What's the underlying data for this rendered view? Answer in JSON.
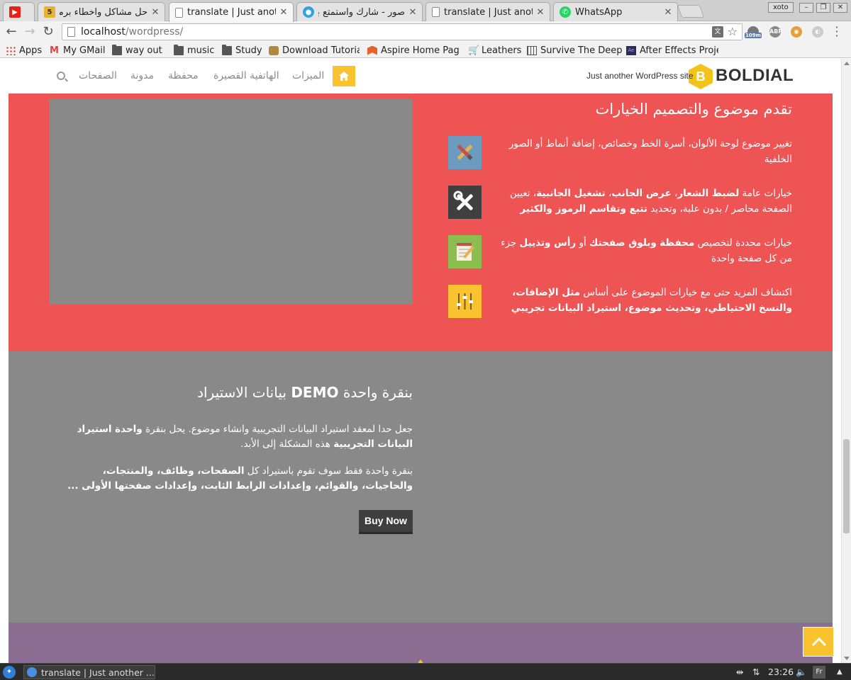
{
  "browser": {
    "tabs": [
      {
        "title": "",
        "favicon": "youtube-icon",
        "color": "#e62117"
      },
      {
        "title": "حل مشاكل واخطاء برمج",
        "favicon": "number-5-icon",
        "color": "#e8b233",
        "glyph": "5"
      },
      {
        "title": "translate | Just anoth",
        "favicon": "page-icon",
        "active": true
      },
      {
        "title": "صور - شارك واستمتع بأ",
        "favicon": "photos-icon",
        "color": "#2aa5e0"
      },
      {
        "title": "translate | Just anoth",
        "favicon": "page-icon"
      },
      {
        "title": "WhatsApp",
        "favicon": "whatsapp-icon",
        "color": "#25d366"
      }
    ],
    "window_user": "xoto",
    "url_host": "localhost",
    "url_path": "/wordpress/",
    "ext_badge": "109m",
    "bookmarks": [
      {
        "label": "Apps",
        "icon": "apps-grid-icon"
      },
      {
        "label": "My GMail",
        "icon": "gmail-icon"
      },
      {
        "label": "way out",
        "icon": "folder-icon"
      },
      {
        "label": "music",
        "icon": "folder-icon"
      },
      {
        "label": "Study",
        "icon": "folder-icon"
      },
      {
        "label": "Download Tutorial",
        "icon": "badge-icon"
      },
      {
        "label": "Aspire Home Page",
        "icon": "magento-icon"
      },
      {
        "label": "Leathers",
        "icon": "cart-icon"
      },
      {
        "label": "Survive The Deep",
        "icon": "grid-icon"
      },
      {
        "label": "After Effects Proje",
        "icon": "ae-icon"
      }
    ]
  },
  "site": {
    "logo_letter": "B",
    "logo_text": "BOLDIAL",
    "tagline": "Just another WordPress site",
    "menu": [
      "الميزات",
      "الهاتفية القصيرة",
      "محفظة",
      "مدونة",
      "الصفحات"
    ],
    "accent": "#f9c22e",
    "red": "#ee5454",
    "grey": "#898989",
    "purple": "#8c6d92"
  },
  "red_section": {
    "title": "تقدم موضوع والتصميم الخيارات",
    "features": [
      {
        "icon": "brush-pencil-icon",
        "bg": "#6c9bc0",
        "html": "تغيير موضوع لوحة الألوان، أسرة الخط وخصائص، إضافة أنماط أو الصور الخلفية"
      },
      {
        "icon": "tools-icon",
        "bg": "#3f3f3f",
        "html": "خيارات عامة <b>لضبط الشعار</b>، <b>عرض الجانب</b>، <b>تشغيل الجانبية</b>، تعيين الصفحة محاصر / بدون علبة، وتحديد <b>تتبع وتقاسم الرموز والكثير</b>"
      },
      {
        "icon": "notepad-icon",
        "bg": "#8bbd4f",
        "html": "خيارات محددة لتخصيص <b>محفظة</b> <b>وبلوق صفحتك</b> أو <b>رأس وتذييل</b> جزء من كل صفحة واحدة"
      },
      {
        "icon": "sliders-icon",
        "bg": "#f9c22e",
        "html": "اكتشاف المزيد حتى مع خيارات الموضوع على أساس <b>مثل الإضافات، والنسخ الاحتياطي، وتحديث موضوع، استيراد البيانات تجريبي</b>"
      }
    ]
  },
  "grey_section": {
    "title_prefix": "بنقرة واحدة",
    "title_demo": "DEMO",
    "title_suffix": "بيانات الاستيراد",
    "p1": "جعل حدا لمعقد استيراد البيانات التجريبية وانشاء موضوع. يحل بنقرة <b>واحدة استيراد البيانات التجريبية</b> هذه المشكلة إلى الأبد.",
    "p2": "بنقرة واحدة فقط سوف تقوم باستيراد كل <b>الصفحات، وظائف، والمنتجات، والحاجيات، والقوائم، وإعدادات الرابط الثابت، وإعدادات صفحتها الأولى ...</b>",
    "buy_label": "Buy Now"
  },
  "taskbar": {
    "task_label": "translate | Just another ...",
    "time": "23:26",
    "lang": "Fr"
  }
}
